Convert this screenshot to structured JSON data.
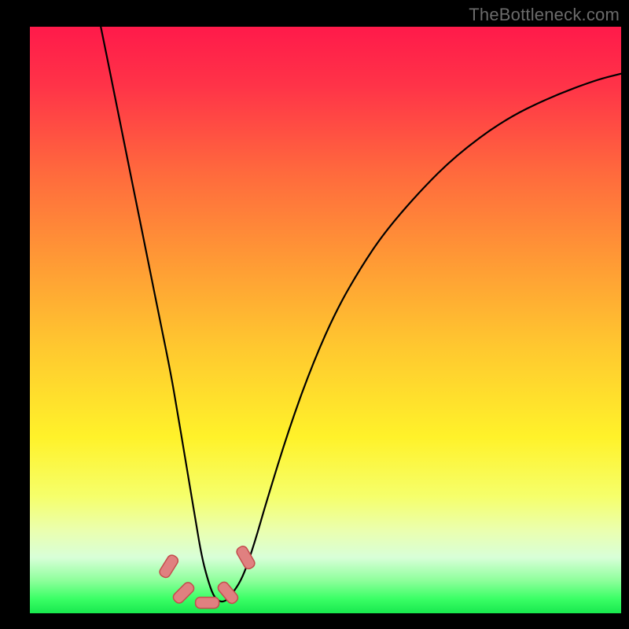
{
  "watermark": "TheBottleneck.com",
  "plot": {
    "margin_left": 38,
    "margin_right": 10,
    "margin_top": 34,
    "margin_bottom": 20,
    "inner_width": 752,
    "inner_height": 746
  },
  "gradient_stops": [
    {
      "offset": 0.0,
      "color": "#ff1a4a"
    },
    {
      "offset": 0.1,
      "color": "#ff3348"
    },
    {
      "offset": 0.25,
      "color": "#ff6a3d"
    },
    {
      "offset": 0.4,
      "color": "#ff9a35"
    },
    {
      "offset": 0.55,
      "color": "#ffc92f"
    },
    {
      "offset": 0.7,
      "color": "#fff22a"
    },
    {
      "offset": 0.8,
      "color": "#f6ff6a"
    },
    {
      "offset": 0.86,
      "color": "#eaffb0"
    },
    {
      "offset": 0.905,
      "color": "#d8ffd8"
    },
    {
      "offset": 0.945,
      "color": "#8cff9a"
    },
    {
      "offset": 0.975,
      "color": "#3bff66"
    },
    {
      "offset": 1.0,
      "color": "#18e84e"
    }
  ],
  "chart_data": {
    "type": "line",
    "title": "",
    "xlabel": "",
    "ylabel": "",
    "xlim": [
      0,
      100
    ],
    "ylim": [
      0,
      100
    ],
    "grid": false,
    "legend": false,
    "series": [
      {
        "name": "curve",
        "x": [
          12,
          14,
          16,
          18,
          20,
          22,
          24,
          25,
          26,
          27,
          28,
          29,
          30,
          31,
          32,
          33,
          34,
          36,
          38,
          40,
          44,
          48,
          52,
          56,
          60,
          66,
          72,
          80,
          88,
          96,
          100
        ],
        "y": [
          100,
          90,
          80,
          70,
          60,
          50,
          40,
          34,
          28,
          22,
          16,
          10,
          6,
          3,
          2,
          2,
          3,
          6,
          12,
          19,
          32,
          43,
          52,
          59,
          65,
          72,
          78,
          84,
          88,
          91,
          92
        ]
      }
    ],
    "markers": [
      {
        "x": 23.5,
        "y": 8.0,
        "angle": -58
      },
      {
        "x": 26.0,
        "y": 3.5,
        "angle": -45
      },
      {
        "x": 30.0,
        "y": 1.8,
        "angle": 0
      },
      {
        "x": 33.5,
        "y": 3.5,
        "angle": 50
      },
      {
        "x": 36.5,
        "y": 9.5,
        "angle": 60
      }
    ],
    "marker_style": {
      "fill": "#e08080",
      "stroke": "#c44d4d",
      "rx": 6,
      "width": 30,
      "height": 14
    }
  }
}
